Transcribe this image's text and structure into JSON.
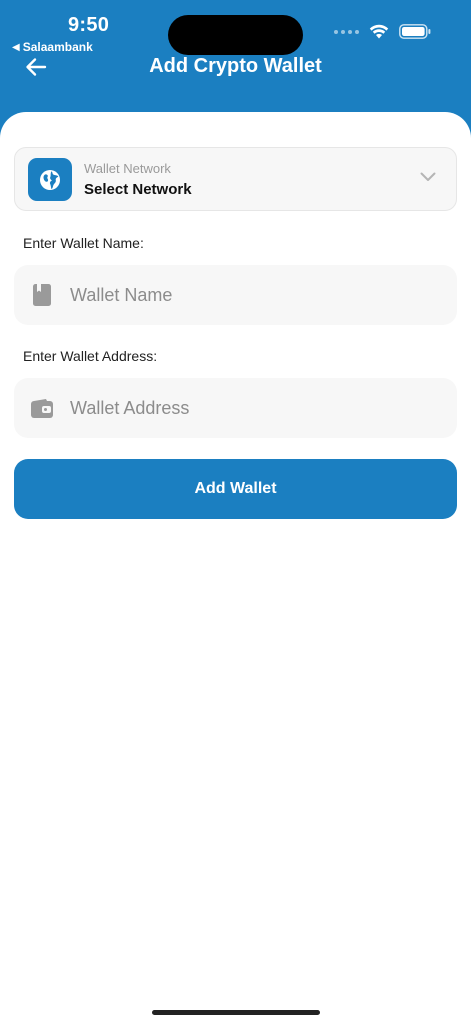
{
  "status_bar": {
    "time": "9:50",
    "back_app": "Salaambank",
    "icons": [
      "cellular-signal-icon",
      "wifi-icon",
      "battery-icon"
    ]
  },
  "header": {
    "title": "Add Crypto Wallet",
    "back_icon": "arrow-left-icon"
  },
  "network": {
    "caption": "Wallet Network",
    "value": "Select Network",
    "icon": "globe-icon",
    "dropdown_icon": "chevron-down-icon"
  },
  "wallet_name": {
    "label": "Enter Wallet Name:",
    "placeholder": "Wallet Name",
    "icon": "book-icon"
  },
  "wallet_address": {
    "label": "Enter Wallet Address:",
    "placeholder": "Wallet Address",
    "icon": "wallet-icon"
  },
  "submit": {
    "label": "Add Wallet"
  },
  "colors": {
    "primary": "#1b7fc1",
    "field_bg": "#f7f7f7",
    "icon_gray": "#9a9a9a"
  }
}
